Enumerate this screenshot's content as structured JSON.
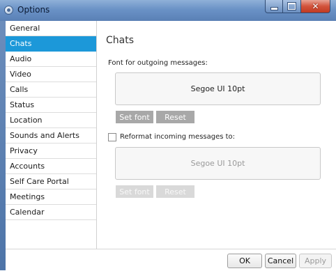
{
  "window": {
    "title": "Options"
  },
  "sidebar": {
    "items": [
      {
        "label": "General",
        "active": false
      },
      {
        "label": "Chats",
        "active": true
      },
      {
        "label": "Audio",
        "active": false
      },
      {
        "label": "Video",
        "active": false
      },
      {
        "label": "Calls",
        "active": false
      },
      {
        "label": "Status",
        "active": false
      },
      {
        "label": "Location",
        "active": false
      },
      {
        "label": "Sounds and Alerts",
        "active": false
      },
      {
        "label": "Privacy",
        "active": false
      },
      {
        "label": "Accounts",
        "active": false
      },
      {
        "label": "Self Care Portal",
        "active": false
      },
      {
        "label": "Meetings",
        "active": false
      },
      {
        "label": "Calendar",
        "active": false
      }
    ]
  },
  "content": {
    "heading": "Chats",
    "outgoing": {
      "label": "Font for outgoing messages:",
      "preview": "Segoe UI 10pt",
      "set_font": "Set font",
      "reset": "Reset"
    },
    "incoming": {
      "checkbox_label": "Reformat incoming messages to:",
      "checked": false,
      "preview": "Segoe UI 10pt",
      "set_font": "Set font",
      "reset": "Reset"
    }
  },
  "footer": {
    "ok": "OK",
    "cancel": "Cancel",
    "apply": "Apply"
  },
  "colors": {
    "accent": "#1c98d9",
    "title_bar": "#6a92c6",
    "close_button": "#c03a22"
  }
}
